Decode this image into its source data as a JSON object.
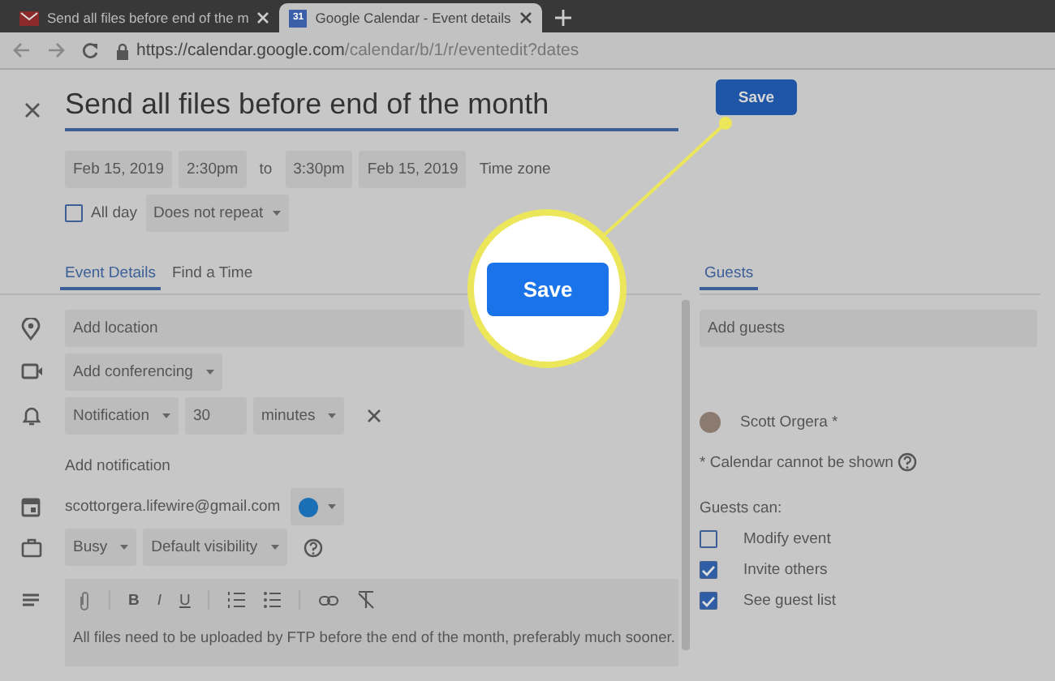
{
  "browser": {
    "tabs": [
      {
        "title": "Send all files before end of the m",
        "selected": false,
        "kind": "mail"
      },
      {
        "title": "Google Calendar - Event details",
        "selected": true,
        "kind": "calendar",
        "badge": "31"
      }
    ],
    "url": {
      "host": "https://calendar.google.com",
      "path": "/calendar/b/1/r/eventedit?dates"
    }
  },
  "event": {
    "title": "Send all files before end of the month",
    "save_label": "Save",
    "start_date": "Feb 15, 2019",
    "start_time": "2:30pm",
    "separator": "to",
    "end_time": "3:30pm",
    "end_date": "Feb 15, 2019",
    "timezone": "Time zone",
    "all_day": {
      "label": "All day",
      "checked": false
    },
    "repeat": "Does not repeat"
  },
  "tabs": [
    {
      "label": "Event Details",
      "selected": true
    },
    {
      "label": "Find a Time",
      "selected": false
    }
  ],
  "details": {
    "location_placeholder": "Add location",
    "conferencing": "Add conferencing",
    "notification": {
      "type": "Notification",
      "value": "30",
      "unit": "minutes"
    },
    "add_notification": "Add notification",
    "calendar": {
      "email": "scottorgera.lifewire@gmail.com",
      "color": "#1a6fb5"
    },
    "availability": "Busy",
    "visibility": "Default visibility",
    "format_buttons": [
      "B",
      "I",
      "U"
    ],
    "description": "All files need to be uploaded by FTP before the end of the month, preferably much sooner."
  },
  "guests": {
    "tab": {
      "label": "Guests",
      "selected": true
    },
    "placeholder": "Add guests",
    "list": [
      {
        "name": "Scott Orgera *"
      }
    ],
    "note": "* Calendar cannot be shown",
    "permissions_title": "Guests can:",
    "permissions": [
      {
        "label": "Modify event",
        "checked": false
      },
      {
        "label": "Invite others",
        "checked": true
      },
      {
        "label": "See guest list",
        "checked": true
      }
    ]
  },
  "callout": {
    "button_label": "Save"
  }
}
